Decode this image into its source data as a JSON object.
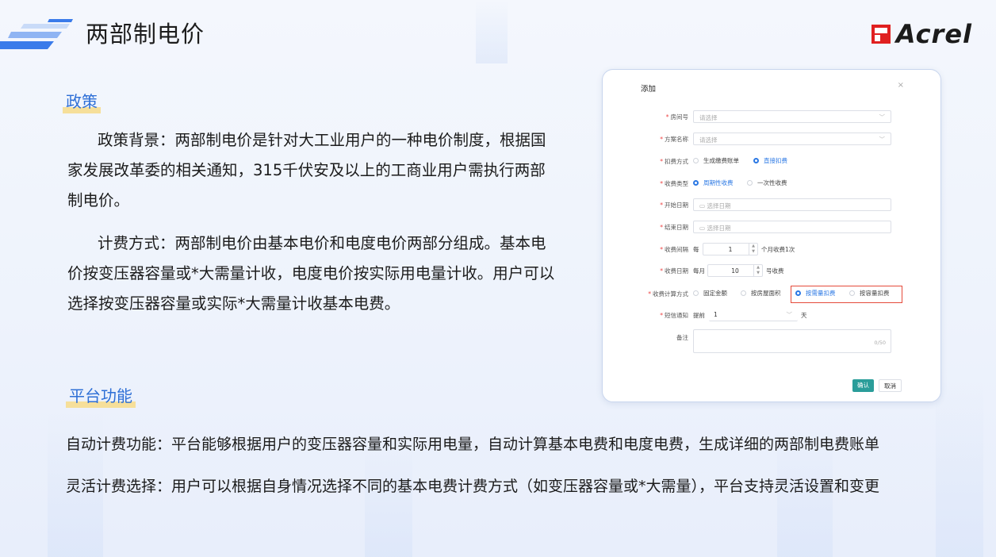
{
  "header": {
    "title": "两部制电价",
    "brand": "Acrel"
  },
  "policy": {
    "heading": "政策",
    "paragraphs": [
      "政策背景：两部制电价是针对大工业用户的一种电价制度，根据国家发展改革委的相关通知，315千伏安及以上的工商业用户需执行两部制电价。",
      "计费方式：两部制电价由基本电价和电度电价两部分组成。基本电价按变压器容量或*大需量计收，电度电价按实际用电量计收。用户可以选择按变压器容量或实际*大需量计收基本电费。"
    ]
  },
  "platform": {
    "heading": "平台功能",
    "lines": [
      "自动计费功能：平台能够根据用户的变压器容量和实际用电量，自动计算基本电费和电度电费，生成详细的两部制电费账单",
      "灵活计费选择：用户可以根据自身情况选择不同的基本电费计费方式（如变压器容量或*大需量），平台支持灵活设置和变更"
    ]
  },
  "dialog": {
    "title": "添加",
    "close": "×",
    "room": {
      "label": "房间号",
      "placeholder": "请选择"
    },
    "plan": {
      "label": "方案名称",
      "placeholder": "请选择"
    },
    "deduct": {
      "label": "扣费方式",
      "options": [
        "生成缴费账单",
        "直接扣费"
      ],
      "selected": "直接扣费"
    },
    "charge_type": {
      "label": "收费类型",
      "options": [
        "周期性收费",
        "一次性收费"
      ],
      "selected": "周期性收费"
    },
    "start_date": {
      "label": "开始日期",
      "placeholder": "选择日期"
    },
    "end_date": {
      "label": "结束日期",
      "placeholder": "选择日期"
    },
    "interval": {
      "label": "收费间隔",
      "prefix": "每",
      "value": "1",
      "suffix": "个月收费1次"
    },
    "charge_day": {
      "label": "收费日期",
      "prefix": "每月",
      "value": "10",
      "suffix": "号收费"
    },
    "calc_method": {
      "label": "收费计算方式",
      "options": [
        "固定金额",
        "按房屋面积",
        "按需量扣费",
        "按容量扣费"
      ],
      "selected": "按需量扣费"
    },
    "sms": {
      "label": "短信通知",
      "prefix": "提前",
      "value": "1",
      "suffix": "天"
    },
    "remark": {
      "label": "备注",
      "counter": "0/50"
    },
    "buttons": {
      "confirm": "确认",
      "cancel": "取消"
    }
  },
  "colors": {
    "accent": "#2b78e4",
    "heading": "#2e6fd6",
    "highlight": "#f6df9a",
    "confirm": "#2a9d9a",
    "redbox": "#e54a3a",
    "brand_red": "#e02020"
  }
}
